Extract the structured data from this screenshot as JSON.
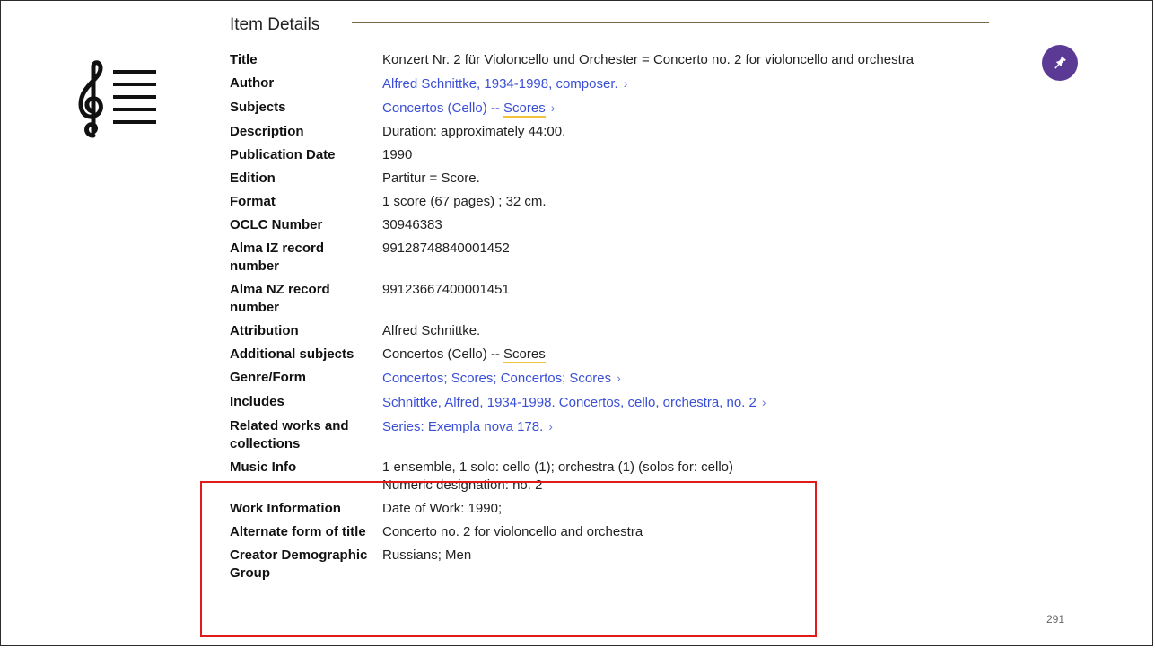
{
  "section": {
    "title": "Item Details"
  },
  "rows": [
    {
      "label": "Title",
      "value": "Konzert Nr. 2 für Violoncello und Orchester = Concerto no. 2 for violoncello and orchestra",
      "link": false
    },
    {
      "label": "Author",
      "value": "Alfred Schnittke, 1934-1998, composer.",
      "link": true
    },
    {
      "label": "Subjects",
      "value_prefix": "Concertos (Cello) -- ",
      "value_hl": "Scores",
      "link": true
    },
    {
      "label": "Description",
      "value": "Duration: approximately 44:00.",
      "link": false
    },
    {
      "label": "Publication Date",
      "value": "1990",
      "link": false
    },
    {
      "label": "Edition",
      "value": "Partitur = Score.",
      "link": false
    },
    {
      "label": "Format",
      "value": "1 score (67 pages) ; 32 cm.",
      "link": false
    },
    {
      "label": "OCLC Number",
      "value": "30946383",
      "link": false
    },
    {
      "label": "Alma IZ record number",
      "value": "99128748840001452",
      "link": false
    },
    {
      "label": "Alma NZ record number",
      "value": "99123667400001451",
      "link": false
    },
    {
      "label": "Attribution",
      "value": "Alfred Schnittke.",
      "link": false
    },
    {
      "label": "Additional subjects",
      "value_prefix": "Concertos (Cello) -- ",
      "value_hl": "Scores",
      "link": false
    },
    {
      "label": "Genre/Form",
      "value": "Concertos; Scores; Concertos; Scores",
      "link": true
    },
    {
      "label": "Includes",
      "value": "Schnittke, Alfred, 1934-1998. Concertos, cello, orchestra, no. 2",
      "link": true
    },
    {
      "label": "Related works and collections",
      "value": "Series: Exempla nova 178.",
      "link": true
    },
    {
      "label": "Music Info",
      "value": "1 ensemble, 1 solo: cello (1); orchestra (1) (solos for: cello)",
      "value2": "Numeric designation: no. 2",
      "link": false
    },
    {
      "label": "Work Information",
      "value": "Date of Work: 1990;",
      "link": false
    },
    {
      "label": "Alternate form of title",
      "value": "Concerto no. 2 for violoncello and orchestra",
      "link": false
    },
    {
      "label": "Creator Demographic Group",
      "value": "Russians; Men",
      "link": false
    }
  ],
  "chevron": "›",
  "page_number": "291",
  "icons": {
    "music": "treble-clef-list-icon",
    "pin": "pin-icon"
  },
  "colors": {
    "link": "#3a4fd6",
    "pin_bg": "#5b3a96",
    "highlight_box": "#e01b1b"
  }
}
